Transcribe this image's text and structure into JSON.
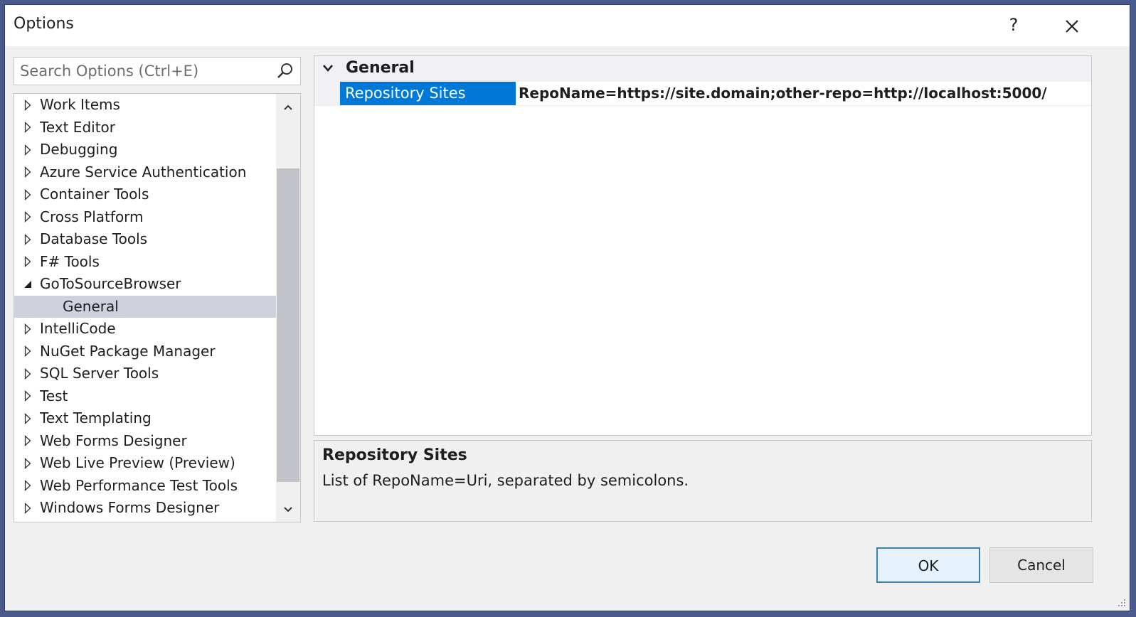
{
  "window": {
    "title": "Options",
    "help_label": "?"
  },
  "search": {
    "placeholder": "Search Options (Ctrl+E)",
    "value": ""
  },
  "tree": {
    "items": [
      {
        "label": "Work Items",
        "state": "collapsed"
      },
      {
        "label": "Text Editor",
        "state": "collapsed"
      },
      {
        "label": "Debugging",
        "state": "collapsed"
      },
      {
        "label": "Azure Service Authentication",
        "state": "collapsed"
      },
      {
        "label": "Container Tools",
        "state": "collapsed"
      },
      {
        "label": "Cross Platform",
        "state": "collapsed"
      },
      {
        "label": "Database Tools",
        "state": "collapsed"
      },
      {
        "label": "F# Tools",
        "state": "collapsed"
      },
      {
        "label": "GoToSourceBrowser",
        "state": "expanded"
      },
      {
        "label": "General",
        "state": "child-selected"
      },
      {
        "label": "IntelliCode",
        "state": "collapsed"
      },
      {
        "label": "NuGet Package Manager",
        "state": "collapsed"
      },
      {
        "label": "SQL Server Tools",
        "state": "collapsed"
      },
      {
        "label": "Test",
        "state": "collapsed"
      },
      {
        "label": "Text Templating",
        "state": "collapsed"
      },
      {
        "label": "Web Forms Designer",
        "state": "collapsed"
      },
      {
        "label": "Web Live Preview (Preview)",
        "state": "collapsed"
      },
      {
        "label": "Web Performance Test Tools",
        "state": "collapsed"
      },
      {
        "label": "Windows Forms Designer",
        "state": "collapsed"
      }
    ]
  },
  "property_grid": {
    "category": "General",
    "property_name": "Repository Sites",
    "property_value": "RepoName=https://site.domain;other-repo=http://localhost:5000/"
  },
  "description": {
    "title": "Repository Sites",
    "text": "List of RepoName=Uri, separated by semicolons."
  },
  "buttons": {
    "ok": "OK",
    "cancel": "Cancel"
  },
  "colors": {
    "selection_blue": "#0078d7",
    "tree_selection": "#cfd2dc",
    "window_border": "#4a5a8c"
  }
}
